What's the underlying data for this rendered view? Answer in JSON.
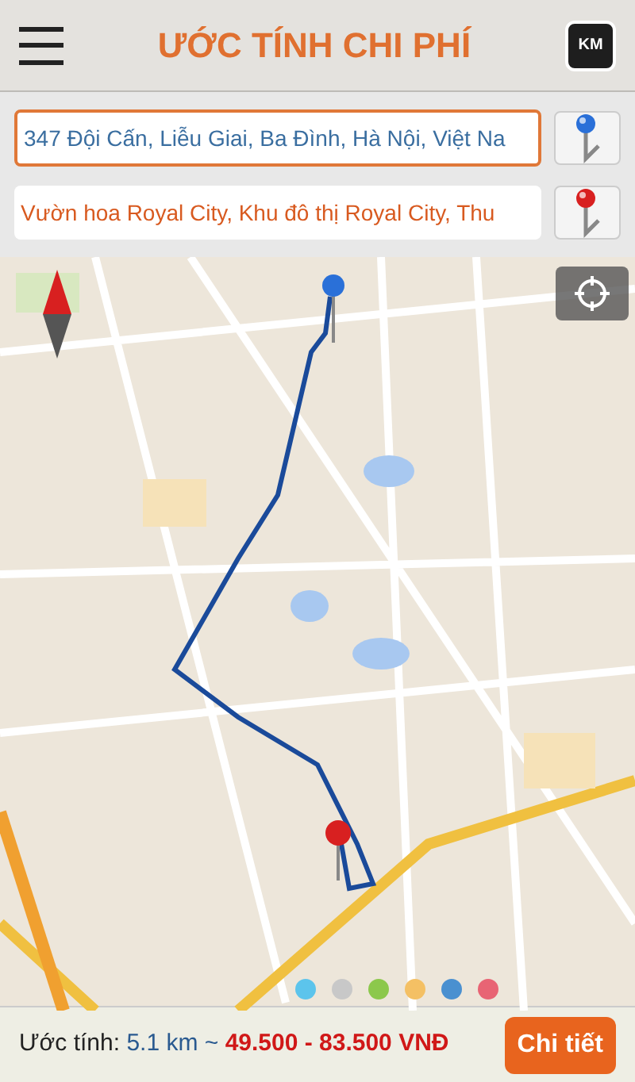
{
  "header": {
    "title": "ƯỚC TÍNH CHI PHÍ",
    "unit_button": "KM"
  },
  "route": {
    "origin": "347 Đội Cấn, Liễu Giai, Ba Đình, Hà Nội, Việt Na",
    "destination": "Vườn hoa Royal City, Khu đô thị Royal City, Thu"
  },
  "color_dots": [
    {
      "color": "#5cc4ec"
    },
    {
      "color": "#c8c8c8"
    },
    {
      "color": "#8cc84c"
    },
    {
      "color": "#f4c064"
    },
    {
      "color": "#4a90d0"
    },
    {
      "color": "#e86474"
    }
  ],
  "summary": {
    "label": "Ước tính:",
    "distance": "5.1 km ~",
    "price": "49.500 - 83.500 VNĐ",
    "detail_button": "Chi tiết"
  }
}
